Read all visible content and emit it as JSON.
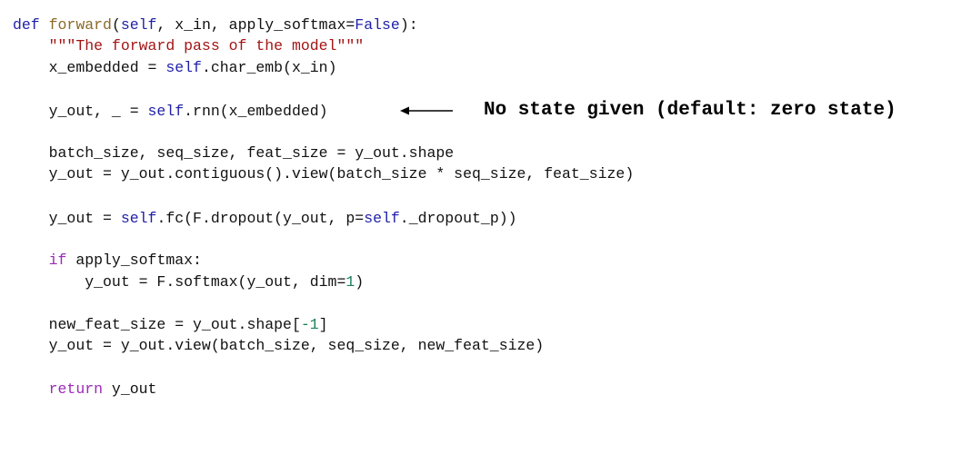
{
  "code": {
    "line1": {
      "kw_def": "def",
      "fn_name": "forward",
      "open_paren": "(",
      "self": "self",
      "args": ", x_in, apply_softmax=",
      "false": "False",
      "close": "):"
    },
    "line2": {
      "indent": "    ",
      "docstring": "\"\"\"The forward pass of the model\"\"\""
    },
    "line3": {
      "indent": "    ",
      "lhs": "x_embedded = ",
      "self": "self",
      "rhs": ".char_emb(x_in)"
    },
    "line4": {
      "indent": "    ",
      "lhs": "y_out, _ = ",
      "self": "self",
      "rhs": ".rnn(x_embedded)"
    },
    "line5": {
      "indent": "    ",
      "text": "batch_size, seq_size, feat_size = y_out.shape"
    },
    "line6": {
      "indent": "    ",
      "text": "y_out = y_out.contiguous().view(batch_size * seq_size, feat_size)"
    },
    "line7": {
      "indent": "    ",
      "lhs": "y_out = ",
      "self1": "self",
      "mid": ".fc(F.dropout(y_out, p=",
      "self2": "self",
      "rhs": "._dropout_p))"
    },
    "line8": {
      "indent": "    ",
      "kw_if": "if",
      "rest": " apply_softmax:"
    },
    "line9": {
      "indent": "        ",
      "lhs": "y_out = F.softmax(y_out, dim=",
      "num": "1",
      "rhs": ")"
    },
    "line10": {
      "indent": "    ",
      "lhs": "new_feat_size = y_out.shape[",
      "num": "-1",
      "rhs": "]"
    },
    "line11": {
      "indent": "    ",
      "text": "y_out = y_out.view(batch_size, seq_size, new_feat_size)"
    },
    "line12": {
      "indent": "    ",
      "kw_return": "return",
      "rest": " y_out"
    }
  },
  "annotation": {
    "text": "No state given (default: zero state)",
    "arrow_icon": "arrow-left-icon"
  },
  "colors": {
    "keyword_blue": "#1f1fa8",
    "keyword_purple": "#9b2bb5",
    "function_name": "#8a6a2a",
    "string": "#a31515",
    "number": "#1b7f5a",
    "text": "#111111"
  }
}
